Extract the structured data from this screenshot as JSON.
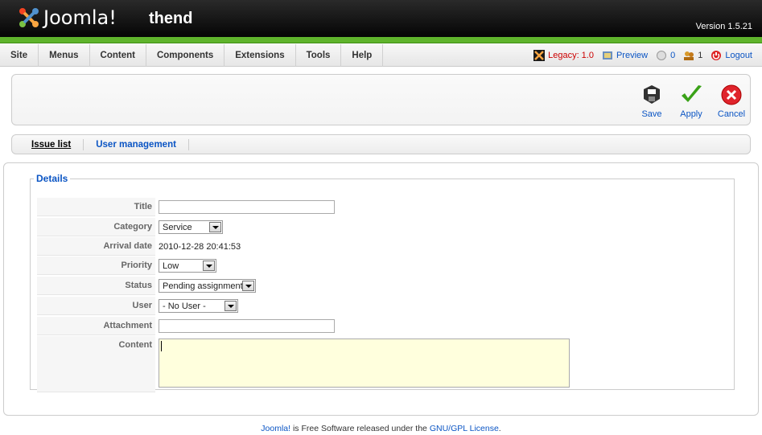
{
  "header": {
    "logo_text": "Joomla!",
    "site_name": "thend",
    "version": "Version 1.5.21"
  },
  "menu": {
    "items": [
      "Site",
      "Menus",
      "Content",
      "Components",
      "Extensions",
      "Tools",
      "Help"
    ]
  },
  "status": {
    "legacy": "Legacy: 1.0",
    "preview": "Preview",
    "messages": "0",
    "users": "1",
    "logout": "Logout"
  },
  "toolbar": {
    "save": "Save",
    "apply": "Apply",
    "cancel": "Cancel"
  },
  "submenu": {
    "issue_list": "Issue list",
    "user_management": "User management"
  },
  "form": {
    "legend": "Details",
    "title_label": "Title",
    "title_value": "",
    "category_label": "Category",
    "category_value": "Service",
    "arrival_label": "Arrival date",
    "arrival_value": "2010-12-28 20:41:53",
    "priority_label": "Priority",
    "priority_value": "Low",
    "status_label": "Status",
    "status_value": "Pending assignment",
    "user_label": "User",
    "user_value": "- No User -",
    "attachment_label": "Attachment",
    "content_label": "Content"
  },
  "footer": {
    "joomla_link": "Joomla!",
    "text": " is Free Software released under the ",
    "license_link": "GNU/GPL License",
    "end": "."
  },
  "colors": {
    "accent_green": "#5fb42c",
    "link_blue": "#0b55c4",
    "legacy_red": "#cc0000",
    "textarea_bg": "#ffffdd"
  }
}
